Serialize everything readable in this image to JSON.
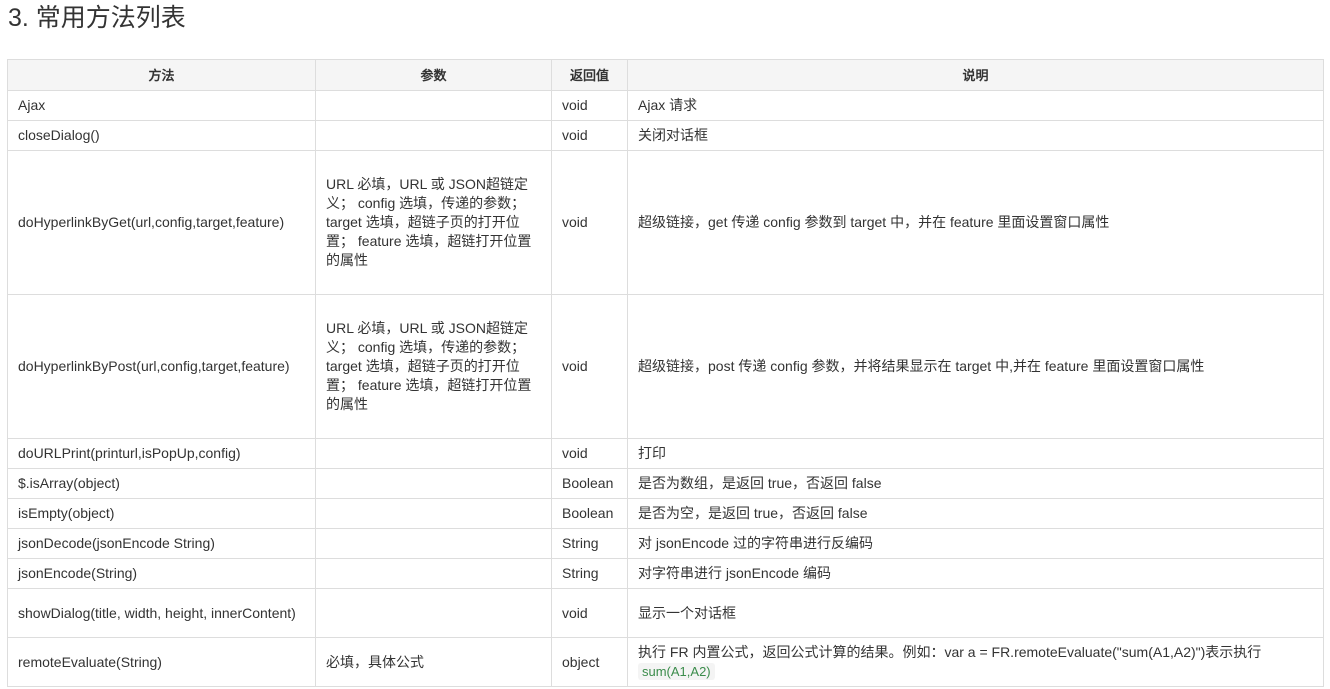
{
  "page": {
    "title": "3. 常用方法列表"
  },
  "table": {
    "headers": [
      "方法",
      "参数",
      "返回值",
      "说明"
    ],
    "rows": [
      {
        "method": "Ajax",
        "params": "",
        "returns": "void",
        "description": "Ajax 请求"
      },
      {
        "method": "closeDialog()",
        "params": "",
        "returns": "void",
        "description": "关闭对话框"
      },
      {
        "method": "doHyperlinkByGet(url,config,target,feature)",
        "params": "URL 必填，URL 或 JSON超链定义；\nconfig 选填，传递的参数；\ntarget 选填，超链子页的打开位置；\nfeature 选填，超链打开位置的属性",
        "returns": "void",
        "description": "超级链接，get 传递 config 参数到 target 中，并在 feature 里面设置窗口属性"
      },
      {
        "method": "doHyperlinkByPost(url,config,target,feature)",
        "params": "URL 必填，URL 或 JSON超链定义；\nconfig 选填，传递的参数；\ntarget 选填，超链子页的打开位置；\nfeature 选填，超链打开位置的属性",
        "returns": "void",
        "description": "超级链接，post 传递 config 参数，并将结果显示在 target 中,并在 feature 里面设置窗口属性"
      },
      {
        "method": "doURLPrint(printurl,isPopUp,config)",
        "params": "",
        "returns": "void",
        "description": "打印"
      },
      {
        "method": "$.isArray(object)",
        "params": "",
        "returns": "Boolean",
        "description": "是否为数组，是返回 true，否返回 false"
      },
      {
        "method": "isEmpty(object)",
        "params": "",
        "returns": "Boolean",
        "description": "是否为空，是返回 true，否返回 false"
      },
      {
        "method": "jsonDecode(jsonEncode String)",
        "params": "",
        "returns": "String",
        "description": "对 jsonEncode 过的字符串进行反编码"
      },
      {
        "method": "jsonEncode(String)",
        "params": "",
        "returns": "String",
        "description": "对字符串进行 jsonEncode 编码"
      },
      {
        "method": "showDialog(title, width, height, innerContent)",
        "params": "",
        "returns": "void",
        "description": "显示一个对话框"
      },
      {
        "method": "remoteEvaluate(String)",
        "params": "必填，具体公式",
        "returns": "object",
        "description": "执行 FR 内置公式，返回公式计算的结果。例如：var a = FR.remoteEvaluate(\"sum(A1,A2)\")表示执行",
        "description_code": "sum(A1,A2)"
      }
    ]
  }
}
